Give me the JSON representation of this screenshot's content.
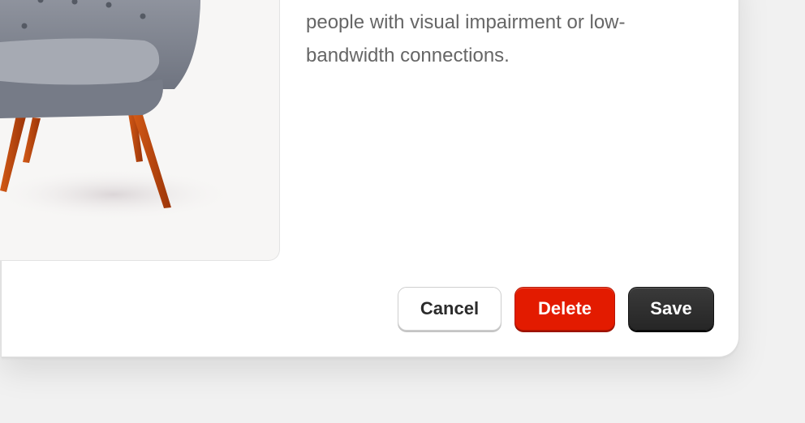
{
  "dialog": {
    "description": "people with visual impairment or low-bandwidth connections.",
    "image": {
      "subject": "armchair",
      "colors": {
        "upholstery": "#8b8f99",
        "legs": "#c2470f"
      }
    },
    "buttons": {
      "cancel_label": "Cancel",
      "delete_label": "Delete",
      "save_label": "Save"
    }
  },
  "colors": {
    "danger": "#e31b00",
    "primary_dark": "#2f2f2f",
    "text_muted": "#666666"
  }
}
